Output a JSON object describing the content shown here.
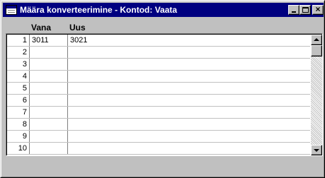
{
  "window": {
    "title": "Määra konverteerimine - Kontod: Vaata",
    "buttons": {
      "minimize": "_",
      "maximize": "□",
      "close": "×"
    }
  },
  "columns": {
    "old": "Vana",
    "new": "Uus"
  },
  "rows": [
    {
      "num": "1",
      "old": "3011",
      "new": "3021"
    },
    {
      "num": "2",
      "old": "",
      "new": ""
    },
    {
      "num": "3",
      "old": "",
      "new": ""
    },
    {
      "num": "4",
      "old": "",
      "new": ""
    },
    {
      "num": "5",
      "old": "",
      "new": ""
    },
    {
      "num": "6",
      "old": "",
      "new": ""
    },
    {
      "num": "7",
      "old": "",
      "new": ""
    },
    {
      "num": "8",
      "old": "",
      "new": ""
    },
    {
      "num": "9",
      "old": "",
      "new": ""
    },
    {
      "num": "10",
      "old": "",
      "new": ""
    }
  ],
  "icons": {
    "window": "window-icon",
    "minimize": "minimize-icon",
    "maximize": "maximize-icon",
    "close": "close-icon",
    "scroll_up": "scroll-up-arrow-icon",
    "scroll_down": "scroll-down-arrow-icon"
  },
  "colors": {
    "titlebar": "#000080",
    "window_bg": "#c0c0c0",
    "grid_bg": "#ffffff"
  }
}
